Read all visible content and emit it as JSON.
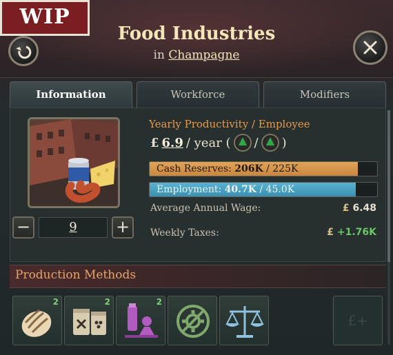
{
  "badge": {
    "label": "WIP"
  },
  "header": {
    "title": "Food Industries",
    "subtitle_prefix": "in",
    "location_link": "Champagne"
  },
  "tabs": [
    {
      "label": "Information",
      "active": true
    },
    {
      "label": "Workforce",
      "active": false
    },
    {
      "label": "Modifiers",
      "active": false
    }
  ],
  "building": {
    "illustration": "food-industries-illustration",
    "level": "9"
  },
  "productivity": {
    "label": "Yearly Productivity / Employee",
    "currency_icon": "£",
    "value": "6.9",
    "unit": "/ year (",
    "separator": "/",
    "close": ")"
  },
  "cash_reserves": {
    "label": "Cash Reserves:",
    "value": "206K",
    "max": "/ 225K",
    "fill_fraction": 0.915,
    "color": "#c9863e"
  },
  "employment": {
    "label": "Employment:",
    "value": "40.7K",
    "max": "/ 45.0K",
    "fill_fraction": 0.905,
    "color": "#3a8fb0"
  },
  "wage": {
    "label": "Average Annual Wage:",
    "currency_icon": "£",
    "value": "6.48"
  },
  "taxes": {
    "label": "Weekly Taxes:",
    "currency_icon": "£",
    "value": "+1.76K"
  },
  "production_methods": {
    "title": "Production Methods",
    "slots": [
      {
        "icon": "bread-icon",
        "count": "2"
      },
      {
        "icon": "canned-goods-icon",
        "count": "2"
      },
      {
        "icon": "distillery-icon",
        "count": "2"
      },
      {
        "icon": "no-automation-icon",
        "count": ""
      },
      {
        "icon": "scales-icon",
        "count": ""
      }
    ],
    "empty_slot": {
      "icon": "pound-plus-icon",
      "label": "£+"
    }
  }
}
